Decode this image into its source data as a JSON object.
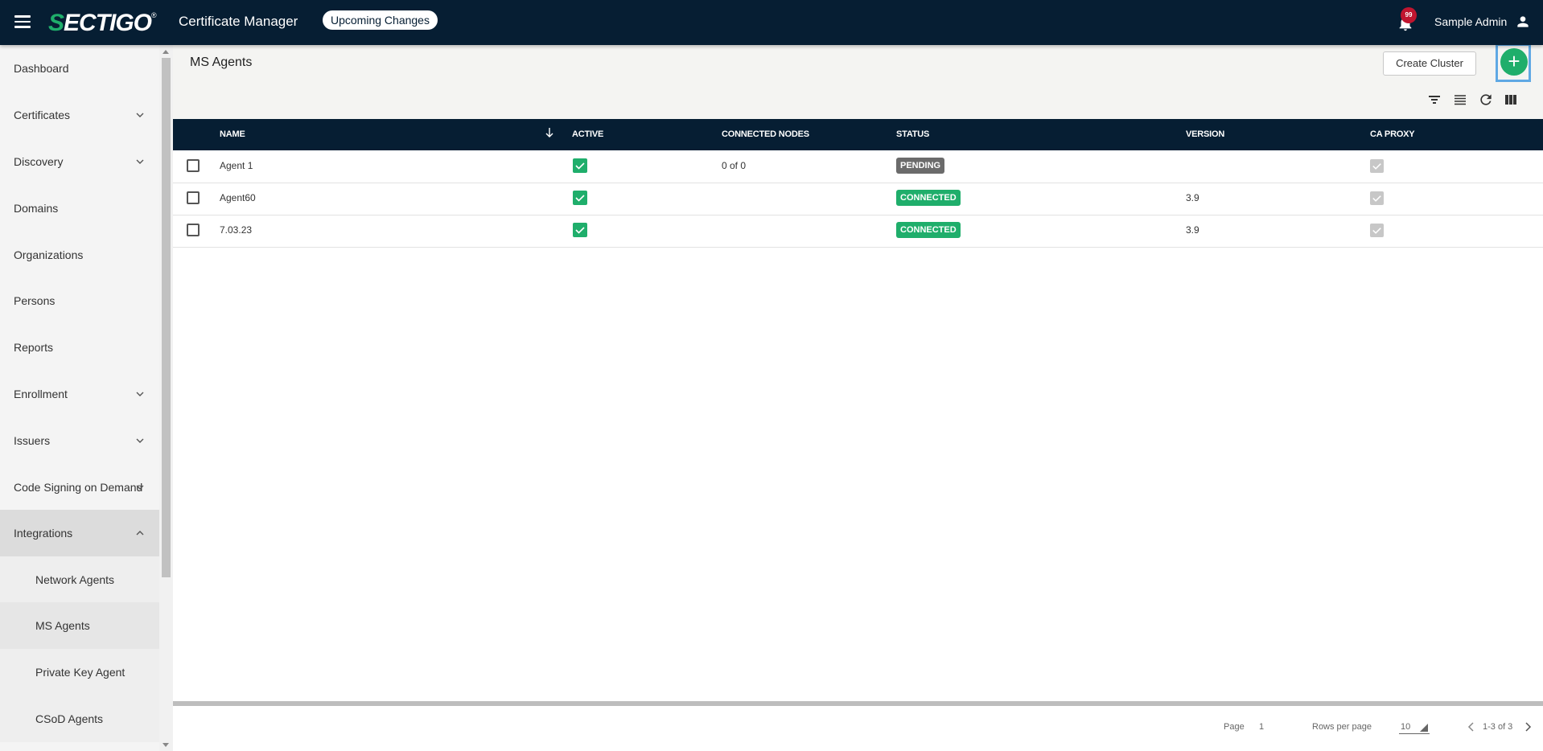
{
  "topbar": {
    "logo_text": "SECTIGO",
    "app_title": "Certificate Manager",
    "upcoming_label": "Upcoming Changes",
    "notification_count": "99",
    "user_name": "Sample Admin",
    "accent": "#1fae6b",
    "bg": "#061e33"
  },
  "sidebar": {
    "items": [
      {
        "label": "Dashboard"
      },
      {
        "label": "Certificates"
      },
      {
        "label": "Discovery"
      },
      {
        "label": "Domains"
      },
      {
        "label": "Organizations"
      },
      {
        "label": "Persons"
      },
      {
        "label": "Reports"
      },
      {
        "label": "Enrollment"
      },
      {
        "label": "Issuers"
      },
      {
        "label": "Code Signing on Demand"
      },
      {
        "label": "Integrations"
      },
      {
        "label": "Network Agents"
      },
      {
        "label": "MS Agents"
      },
      {
        "label": "Private Key Agent"
      },
      {
        "label": "CSoD Agents"
      }
    ]
  },
  "main": {
    "page_title": "MS Agents",
    "create_cluster_label": "Create Cluster",
    "add_label": "+"
  },
  "table": {
    "columns": [
      "NAME",
      "ACTIVE",
      "CONNECTED NODES",
      "STATUS",
      "VERSION",
      "CA PROXY"
    ],
    "rows": [
      {
        "name": "Agent 1",
        "active": true,
        "connected_nodes": "0 of 0",
        "status": "PENDING",
        "version": "",
        "ca_proxy": true
      },
      {
        "name": "Agent60",
        "active": true,
        "connected_nodes": "",
        "status": "CONNECTED",
        "version": "3.9",
        "ca_proxy": true
      },
      {
        "name": "7.03.23",
        "active": true,
        "connected_nodes": "",
        "status": "CONNECTED",
        "version": "3.9",
        "ca_proxy": true
      }
    ],
    "status_colors": {
      "PENDING": "#6b6b6b",
      "CONNECTED": "#1fae6b"
    }
  },
  "footer": {
    "page_label": "Page",
    "page_value": "1",
    "rows_per_page_label": "Rows per page",
    "rows_per_page_value": "10",
    "range_text": "1-3 of 3"
  }
}
